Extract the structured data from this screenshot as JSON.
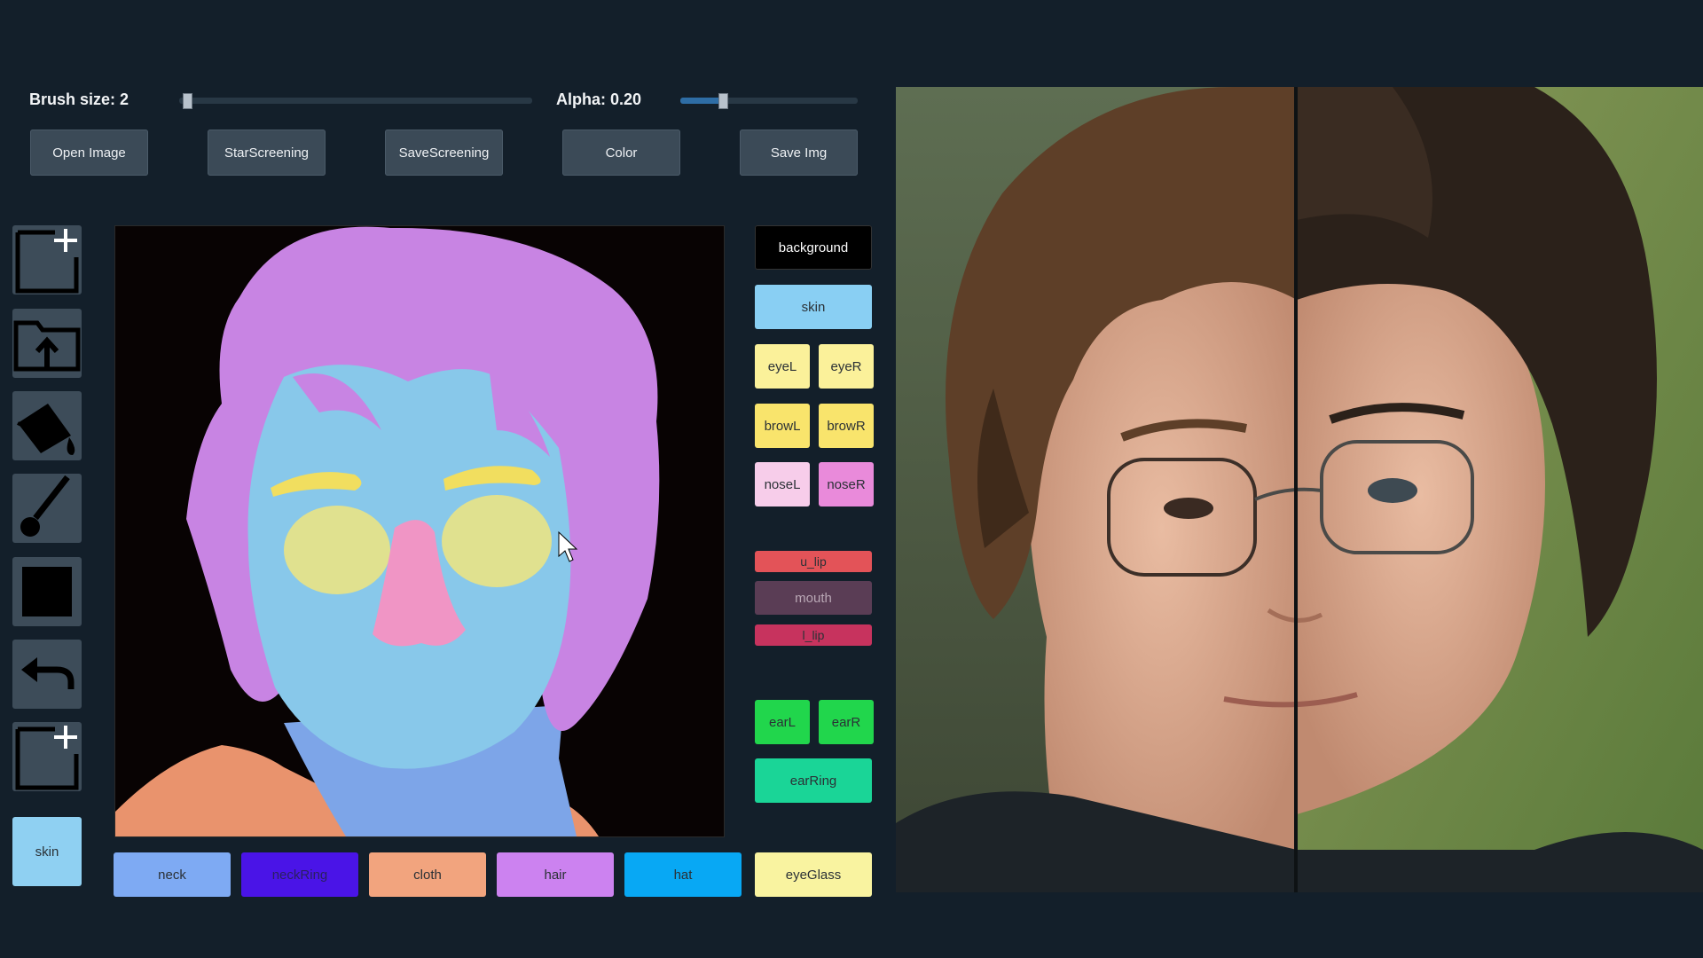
{
  "brush": {
    "label": "Brush size: 2",
    "value": 2
  },
  "alpha": {
    "label": "Alpha: 0.20",
    "value": 0.2
  },
  "toolbar_buttons": {
    "open_image": "Open Image",
    "star_screening": "StarScreening",
    "save_screening": "SaveScreening",
    "color": "Color",
    "save_img": "Save Img"
  },
  "side_tools": [
    "new-file-icon",
    "upload-folder-icon",
    "fill-bucket-icon",
    "brush-icon",
    "rectangle-icon",
    "undo-icon",
    "new-file-icon"
  ],
  "current_label": {
    "text": "skin",
    "color": "#8fd0f2"
  },
  "labels": {
    "background": {
      "text": "background",
      "color": "#000000",
      "text_color": "#ffffff"
    },
    "skin": {
      "text": "skin",
      "color": "#89cff3"
    },
    "eyeL": {
      "text": "eyeL",
      "color": "#fbf19a"
    },
    "eyeR": {
      "text": "eyeR",
      "color": "#fbf19a"
    },
    "browL": {
      "text": "browL",
      "color": "#f9e46c"
    },
    "browR": {
      "text": "browR",
      "color": "#f9e46c"
    },
    "noseL": {
      "text": "noseL",
      "color": "#f7cdea"
    },
    "noseR": {
      "text": "noseR",
      "color": "#e98ada"
    },
    "u_lip": {
      "text": "u_lip",
      "color": "#e35358"
    },
    "mouth": {
      "text": "mouth",
      "color": "#5a3d55",
      "text_color": "#b9a7b5"
    },
    "l_lip": {
      "text": "l_lip",
      "color": "#c7335e"
    },
    "earL": {
      "text": "earL",
      "color": "#21d64c"
    },
    "earR": {
      "text": "earR",
      "color": "#21d64c"
    },
    "earRing": {
      "text": "earRing",
      "color": "#1ad597"
    },
    "neck": {
      "text": "neck",
      "color": "#7eaaf3"
    },
    "neckRing": {
      "text": "neckRing",
      "color": "#4a14e7"
    },
    "cloth": {
      "text": "cloth",
      "color": "#f2a47e"
    },
    "hair": {
      "text": "hair",
      "color": "#cc82f0"
    },
    "hat": {
      "text": "hat",
      "color": "#08a8f4"
    },
    "eyeGlass": {
      "text": "eyeGlass",
      "color": "#f9f3a0"
    }
  }
}
